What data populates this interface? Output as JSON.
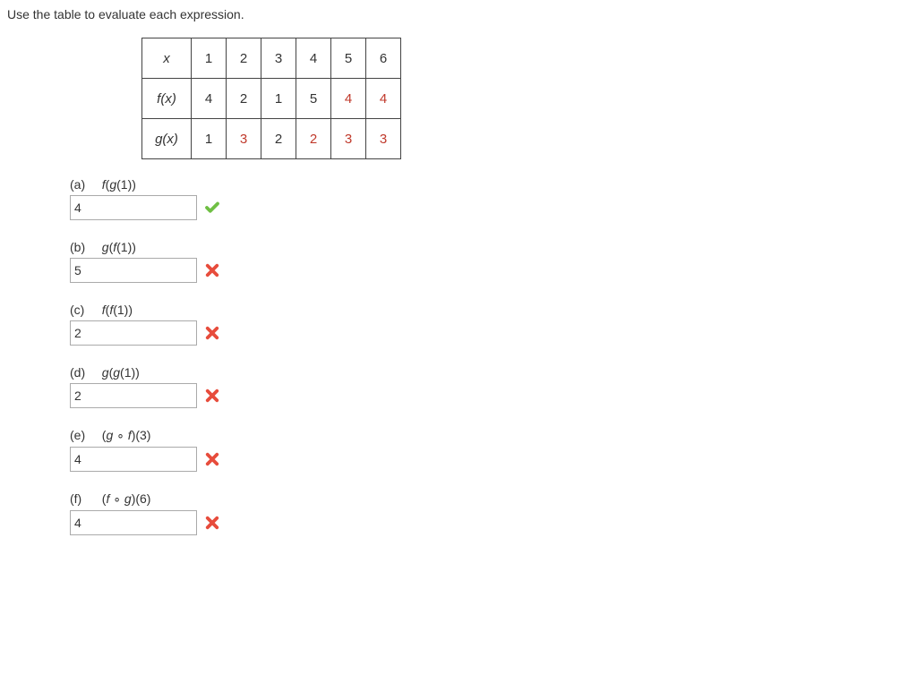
{
  "instruction": "Use the table to evaluate each expression.",
  "table": {
    "header_row": {
      "label": "x",
      "cells": [
        "1",
        "2",
        "3",
        "4",
        "5",
        "6"
      ]
    },
    "rows": [
      {
        "label": "f(x)",
        "cells": [
          "4",
          "2",
          "1",
          "5",
          "4",
          "4"
        ],
        "red": [
          false,
          false,
          false,
          false,
          true,
          true
        ]
      },
      {
        "label": "g(x)",
        "cells": [
          "1",
          "3",
          "2",
          "2",
          "3",
          "3"
        ],
        "red": [
          false,
          true,
          false,
          true,
          true,
          true
        ]
      }
    ]
  },
  "problems": [
    {
      "label": "(a)",
      "expr_html": "<span class='fn'>f</span>(<span class='fn'>g</span>(1))",
      "value": "4",
      "correct": true
    },
    {
      "label": "(b)",
      "expr_html": "<span class='fn'>g</span>(<span class='fn'>f</span>(1))",
      "value": "5",
      "correct": false
    },
    {
      "label": "(c)",
      "expr_html": "<span class='fn'>f</span>(<span class='fn'>f</span>(1))",
      "value": "2",
      "correct": false
    },
    {
      "label": "(d)",
      "expr_html": "<span class='fn'>g</span>(<span class='fn'>g</span>(1))",
      "value": "2",
      "correct": false
    },
    {
      "label": "(e)",
      "expr_html": "(<span class='fn'>g</span> ∘ <span class='fn'>f</span>)(3)",
      "value": "4",
      "correct": false
    },
    {
      "label": "(f)",
      "expr_html": "(<span class='fn'>f</span> ∘ <span class='fn'>g</span>)(6)",
      "value": "4",
      "correct": false
    }
  ]
}
